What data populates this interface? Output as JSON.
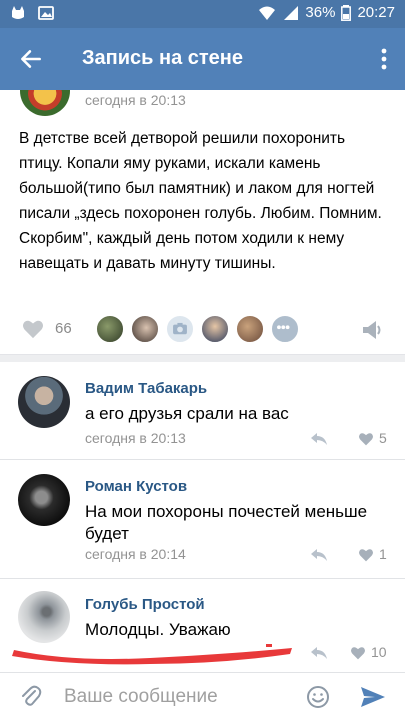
{
  "status_bar": {
    "battery_percent": "36%",
    "time": "20:27"
  },
  "header": {
    "title": "Запись на стене"
  },
  "post": {
    "time": "сегодня в 20:13",
    "text": "В детстве всей детворой решили похоронить птицу. Копали яму руками, искали камень большой(типо был памятник) и лаком для ногтей писали „здесь похоронен голубь. Любим. Помним. Скорбим\", каждый день потом ходили к нему навещать и давать минуту тишины.",
    "likes": "66"
  },
  "comments": [
    {
      "author": "Вадим Табакарь",
      "text": "а его друзья срали на вас",
      "time": "сегодня в 20:13",
      "likes": "5"
    },
    {
      "author": "Роман Кустов",
      "text": "На мои похороны почестей меньше будет",
      "time": "сегодня в 20:14",
      "likes": "1"
    },
    {
      "author": "Голубь Простой",
      "text": "Молодцы. Уважаю",
      "time": "",
      "likes": "10"
    }
  ],
  "composer": {
    "placeholder": "Ваше сообщение"
  },
  "colors": {
    "brand_blue": "#5181b8",
    "status_blue": "#4a76a8",
    "link_blue": "#2a5885",
    "scribble_red": "#e8393a"
  },
  "icons": [
    "back-arrow-icon",
    "more-vertical-icon",
    "heart-icon",
    "share-icon",
    "reply-icon",
    "attach-icon",
    "smile-icon",
    "send-icon",
    "wifi-icon",
    "signal-icon",
    "battery-icon"
  ]
}
